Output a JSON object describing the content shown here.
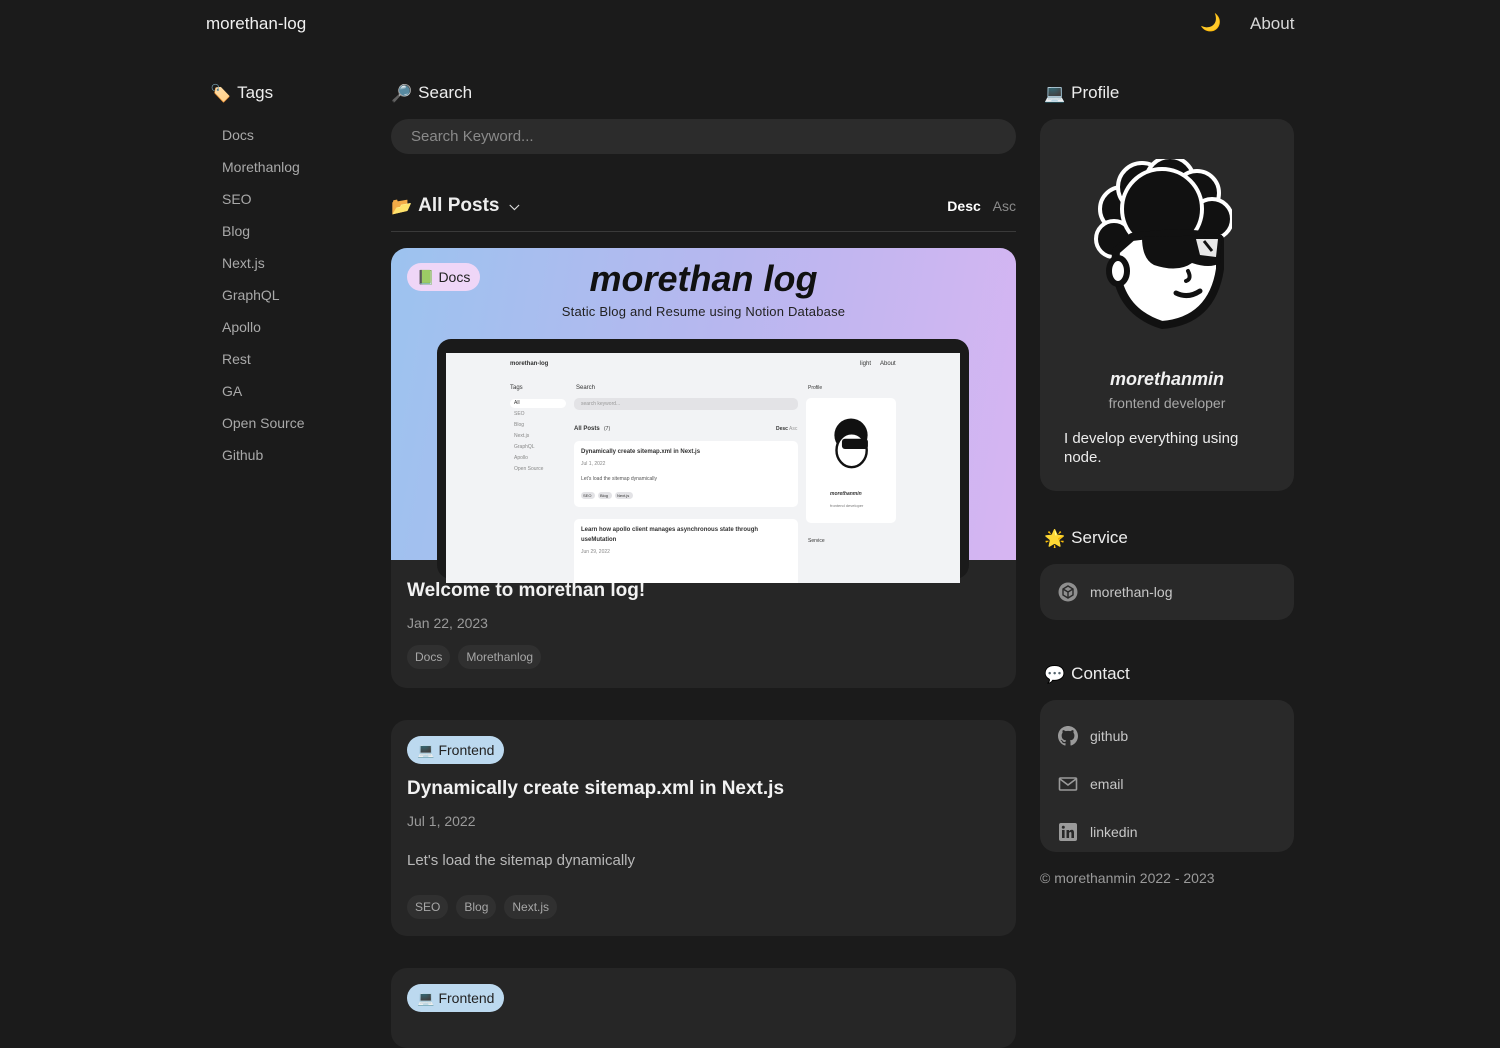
{
  "header": {
    "logo": "morethan-log",
    "theme_icon": "🌙",
    "about": "About"
  },
  "tags": {
    "icon": "🏷️",
    "title": "Tags",
    "items": [
      "Docs",
      "Morethanlog",
      "SEO",
      "Blog",
      "Next.js",
      "GraphQL",
      "Apollo",
      "Rest",
      "GA",
      "Open Source",
      "Github"
    ]
  },
  "search": {
    "icon": "🔎",
    "title": "Search",
    "placeholder": "Search Keyword..."
  },
  "posts": {
    "icon": "📂",
    "title": "All Posts",
    "sort_desc": "Desc",
    "sort_asc": "Asc",
    "items": [
      {
        "category_icon": "📗",
        "category": "Docs",
        "cover_title": "morethan log",
        "cover_subtitle": "Static Blog and Resume using Notion Database",
        "title": "Welcome to morethan log!",
        "date": "Jan 22, 2023",
        "tags": [
          "Docs",
          "Morethanlog"
        ]
      },
      {
        "category_icon": "💻",
        "category": "Frontend",
        "title": "Dynamically create sitemap.xml in Next.js",
        "date": "Jul 1, 2022",
        "summary": "Let's load the sitemap dynamically",
        "tags": [
          "SEO",
          "Blog",
          "Next.js"
        ]
      },
      {
        "category_icon": "💻",
        "category": "Frontend"
      }
    ]
  },
  "cover_screenshot": {
    "logo": "morethan-log",
    "light": "light",
    "about": "About",
    "tags": "Tags",
    "tag_items": [
      "All",
      "SEO",
      "Blog",
      "Next.js",
      "GraphQL",
      "Apollo",
      "Open Source"
    ],
    "search": "Search",
    "search_placeholder": "search keyword...",
    "all_posts": "All Posts",
    "count": "(7)",
    "desc": "Desc",
    "asc": "Asc",
    "post1_title": "Dynamically create sitemap.xml in Next.js",
    "post1_date": "Jul 1, 2022",
    "post1_summary": "Let's load the sitemap dynamically",
    "post1_tags": [
      "SEO",
      "Blog",
      "Next.js"
    ],
    "post2_title_line1": "Learn how apollo client manages asynchronous state through",
    "post2_title_line2": "useMutation",
    "post2_date": "Jun 29, 2022",
    "profile": "Profile",
    "profile_name": "morethanmin",
    "profile_role": "frontend developer",
    "service": "Service"
  },
  "profile": {
    "icon": "💻",
    "title": "Profile",
    "name": "morethanmin",
    "role": "frontend developer",
    "bio": "I develop everything using node."
  },
  "service": {
    "icon": "🌟",
    "title": "Service",
    "item": "morethan-log"
  },
  "contact": {
    "icon": "💬",
    "title": "Contact",
    "items": [
      "github",
      "email",
      "linkedin"
    ]
  },
  "footer": "© morethanmin 2022 - 2023",
  "colors": {
    "background": "#1b1b1b",
    "card": "#262626",
    "docs_pill": "#efd6f7",
    "frontend_pill": "#bcd9ef"
  }
}
